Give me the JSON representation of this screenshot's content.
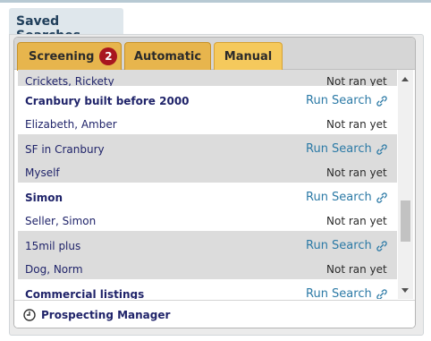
{
  "widget": {
    "title": "Saved Searches"
  },
  "tabs": [
    {
      "label": "Screening",
      "badge": "2"
    },
    {
      "label": "Automatic"
    },
    {
      "label": "Manual",
      "active": true
    }
  ],
  "searches": {
    "partial_top": {
      "name": "Crickets, Rickety",
      "status": "Not ran yet"
    },
    "items": [
      {
        "name": "Cranbury built before 2000",
        "owner": "Elizabeth, Amber",
        "action": "Run Search",
        "status": "Not ran yet"
      },
      {
        "name": "SF in Cranbury",
        "owner": "Myself",
        "action": "Run Search",
        "status": "Not ran yet"
      },
      {
        "name": "Simon",
        "owner": "Seller, Simon",
        "action": "Run Search",
        "status": "Not ran yet"
      },
      {
        "name": "15mil plus",
        "owner": "Dog, Norm",
        "action": "Run Search",
        "status": "Not ran yet"
      },
      {
        "name": "Commercial listings",
        "action": "Run Search"
      }
    ]
  },
  "footer": {
    "label": "Prospecting Manager",
    "icon": "clock-icon"
  },
  "colors": {
    "tab_bg": "#e7b54d",
    "tab_active_bg": "#f5c95c",
    "badge_bg": "#a8161f",
    "link": "#2c7aa6",
    "text_dark": "#20246a",
    "row_alt": "#dcdcdc"
  }
}
